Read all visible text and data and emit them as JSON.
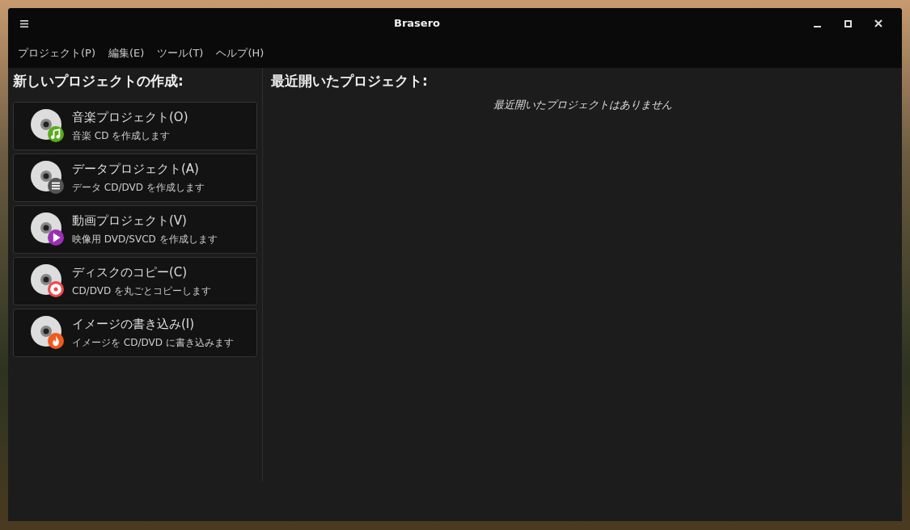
{
  "window": {
    "title": "Brasero"
  },
  "menu": [
    "プロジェクト(P)",
    "編集(E)",
    "ツール(T)",
    "ヘルプ(H)"
  ],
  "new_project": {
    "heading": "新しいプロジェクトの作成:",
    "items": [
      {
        "title": "音楽プロジェクト(O)",
        "subtitle": "音楽 CD を作成します",
        "kind": "music",
        "color": "#5aab1e"
      },
      {
        "title": "データプロジェクト(A)",
        "subtitle": "データ CD/DVD を作成します",
        "kind": "data",
        "color": "#555555"
      },
      {
        "title": "動画プロジェクト(V)",
        "subtitle": "映像用 DVD/SVCD を作成します",
        "kind": "video",
        "color": "#9b2fb5"
      },
      {
        "title": "ディスクのコピー(C)",
        "subtitle": "CD/DVD を丸ごとコピーします",
        "kind": "copy",
        "color": "#f0484f"
      },
      {
        "title": "イメージの書き込み(I)",
        "subtitle": "イメージを CD/DVD に書き込みます",
        "kind": "burn",
        "color": "#f05a1e"
      }
    ]
  },
  "recent": {
    "heading": "最近開いたプロジェクト:",
    "empty_message": "最近開いたプロジェクトはありません"
  }
}
